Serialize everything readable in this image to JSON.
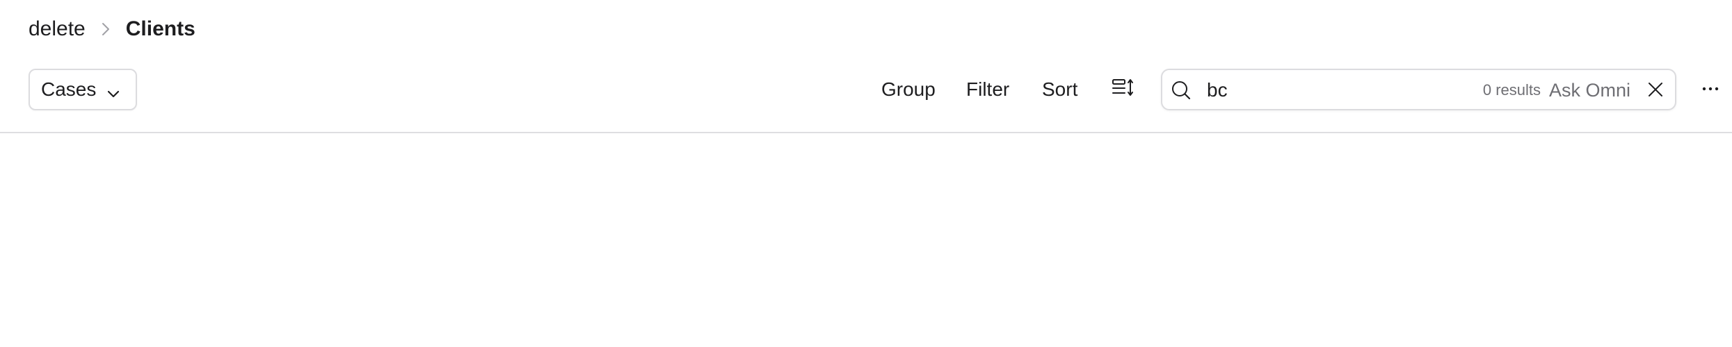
{
  "breadcrumb": {
    "parent": "delete",
    "current": "Clients"
  },
  "toolbar": {
    "view_select": "Cases",
    "group_label": "Group",
    "filter_label": "Filter",
    "sort_label": "Sort",
    "fields_icon": "list-settings-icon",
    "more_icon": "ellipsis-icon"
  },
  "search": {
    "value": "bc",
    "results": "0 results",
    "ask_label": "Ask Omni",
    "icon": "search-icon",
    "clear_icon": "close-icon"
  },
  "colors": {
    "text": "#1d1d1f",
    "muted": "#6e6e73",
    "border": "#dcdcdf",
    "divider": "#dedee1"
  }
}
